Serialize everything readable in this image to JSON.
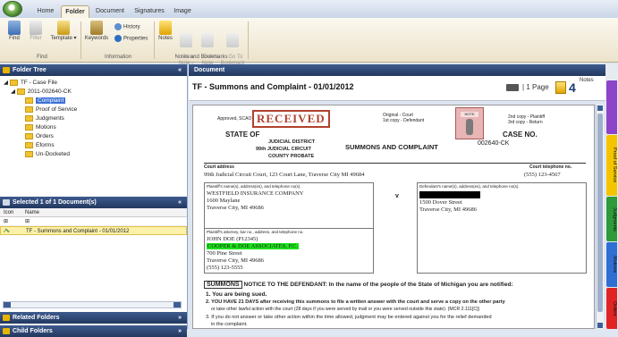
{
  "tabs": [
    "Home",
    "Folder",
    "Document",
    "Signatures",
    "Image"
  ],
  "ribbon": {
    "find": "Find",
    "filter": "Filter",
    "template": "Template",
    "keywords": "Keywords",
    "history": "History",
    "properties": "Properties",
    "notes": "Notes",
    "new_note": "New\nNote -",
    "delete_note": "Delete\nNote",
    "goto_bookmark": "Go To\nBookmark",
    "group_find": "Find",
    "group_info": "Information",
    "group_notes": "Notes and Bookmarks"
  },
  "folder_tree": {
    "title": "Folder Tree",
    "root": "TF - Case File",
    "case": "2011-002640-CK",
    "items": [
      "Complaint",
      "Proof of Service",
      "Judgments",
      "Motions",
      "Orders",
      "Eforms",
      "Un-Docketed"
    ]
  },
  "selected_panel": {
    "title": "Selected 1 of 1 Document(s)",
    "col_icon": "Icon",
    "col_name": "Name",
    "row": "TF - Summons and Complaint - 01/01/2012"
  },
  "related_folders": "Related Folders",
  "child_folders": "Child Folders",
  "document": {
    "header": "Document",
    "title": "TF - Summons and Complaint - 01/01/2012",
    "page_info": "1 Page",
    "notes_count": "4",
    "notes_label": "Notes"
  },
  "side_tabs": [
    "Proof of Service",
    "Judgments",
    "Motions",
    "Orders"
  ],
  "form": {
    "approved": "Approved, SCAO",
    "received": "RECEIVED",
    "original": "Original - Court",
    "first_copy": "1st copy - Defendant",
    "second_copy": "2nd copy - Plaintiff",
    "third_copy": "3rd copy - Return",
    "note_label": "NOTE",
    "state_of": "STATE OF",
    "judicial_district": "JUDICIAL DISTRICT",
    "judicial_circuit": "99th JUDICIAL CIRCUIT",
    "county_probate": "COUNTY PROBATE",
    "summons_title": "SUMMONS AND COMPLAINT",
    "case_no_label": "CASE NO.",
    "case_no": "002640-CK",
    "court_address_label": "Court address",
    "court_phone_label": "Court telephone no.",
    "court_address": "99th Judicial Circuit Court, 123 Court Lane, Traverse City MI 49684",
    "court_phone": "(555) 123-4567",
    "plaintiff_label": "Plaintiff's name(s), address(es), and telephone no(s).",
    "plaintiff_name": "WESTFIELD INSURANCE COMPANY",
    "plaintiff_addr1": "1600 Maylane",
    "plaintiff_addr2": "Traverse City, MI 49686",
    "versus": "v",
    "defendant_label": "Defendant's name(s), address(es), and telephone no(s).",
    "defendant_addr1": "1500 Dover Street",
    "defendant_addr2": "Traverse City, MI 49686",
    "attorney_label": "Plaintiff's attorney, bar no., address, and telephone no.",
    "attorney_name": "JOHN DOE (P12345)",
    "attorney_firm": "COOPER & DOE ASSOCIATES, P.C.",
    "attorney_addr1": "700 Pine Street",
    "attorney_addr2": "Traverse City, MI 49686",
    "attorney_phone": "(555) 123-5555",
    "summons_box": "SUMMONS",
    "notice_text": "NOTICE TO THE DEFENDANT: In the name of the people of the State of Michigan you are notified:",
    "item1": "1. You are being sued.",
    "item2a": "2. YOU HAVE 21 DAYS after receiving this summons to file a written answer with the court and serve a copy on the other party",
    "item2b": "or take other lawful action with the court (28 days if you were served by mail or you were served outside this state). (MCR 2.111[C])",
    "item3a": "3. If you do not answer or take other action within the time allowed, judgment may be entered against you for the relief demanded",
    "item3b": "in the complaint."
  }
}
